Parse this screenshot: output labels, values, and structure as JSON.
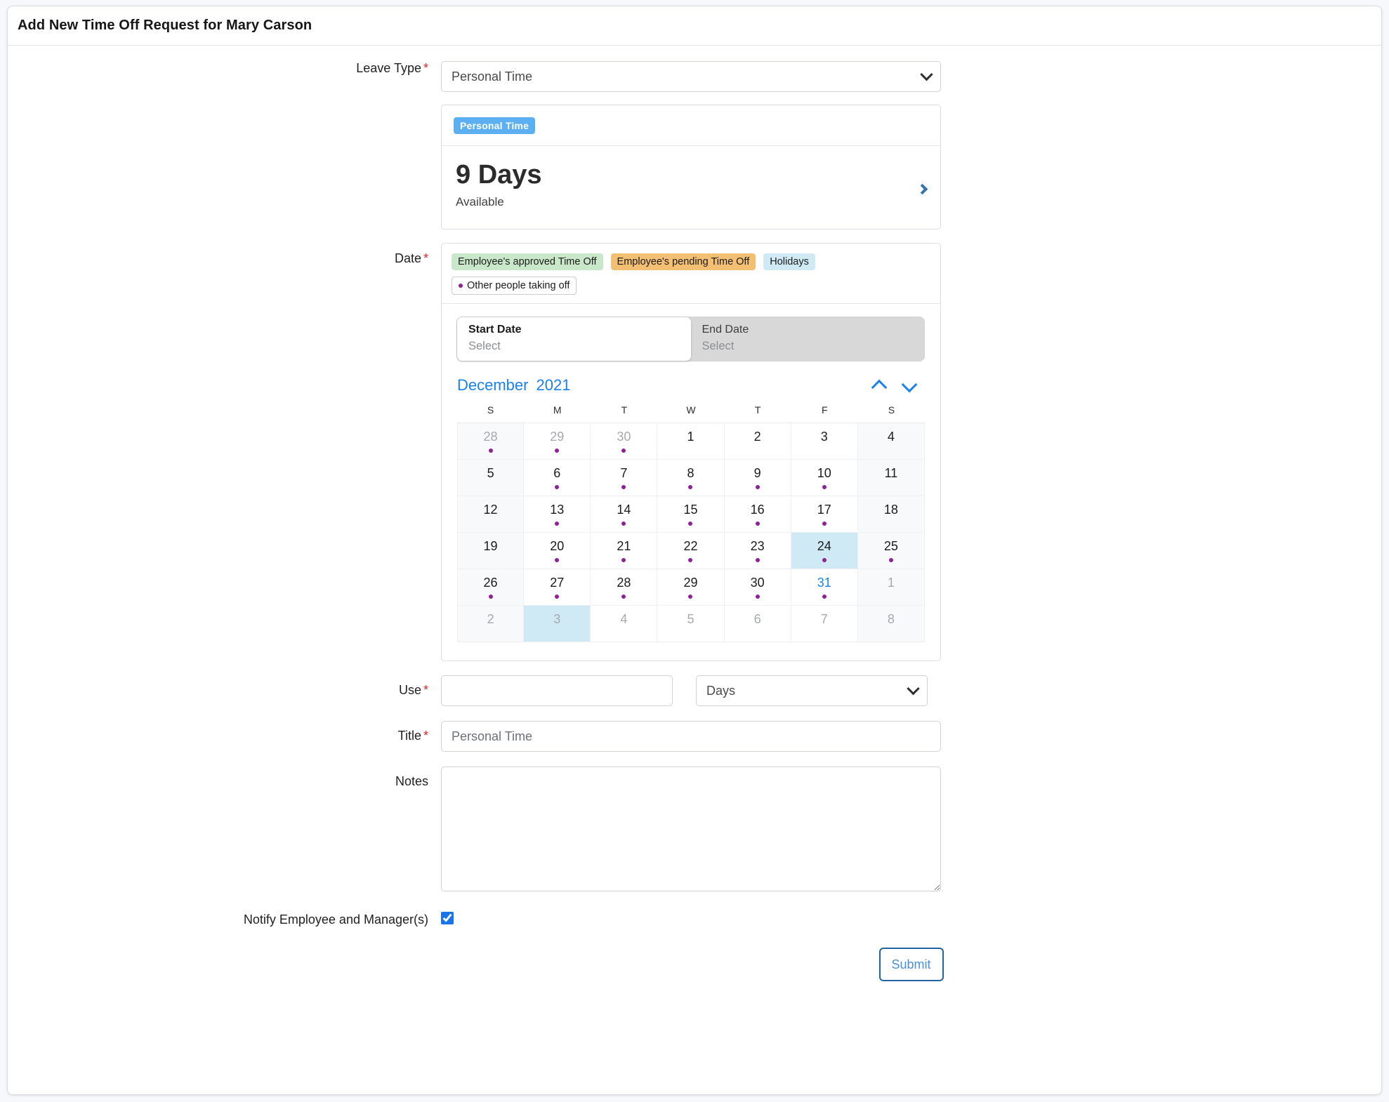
{
  "header": {
    "title": "Add New Time Off Request for Mary Carson"
  },
  "colors": {
    "accent_blue": "#1a82f0",
    "pill_blue": "#5cb0f2",
    "chip_approved": "#c9e8c9",
    "chip_pending": "#f3bf72",
    "chip_holiday": "#cfeaf5",
    "other_dot": "#8e2196",
    "required_star": "#ee2222",
    "submit_border": "#21659e",
    "submit_text": "#4a90d9"
  },
  "leave_type": {
    "label": "Leave Type",
    "required": "*",
    "value": "Personal Time",
    "options": [
      "Personal Time"
    ]
  },
  "balance": {
    "pill_label": "Personal Time",
    "amount": "9 Days",
    "caption": "Available",
    "chevron_icon": "chevron-right-icon"
  },
  "date": {
    "label": "Date",
    "required": "*",
    "legend": [
      {
        "text": "Employee's approved Time Off",
        "style": "approved"
      },
      {
        "text": "Employee's pending Time Off",
        "style": "pending"
      },
      {
        "text": "Holidays",
        "style": "holiday"
      },
      {
        "text": "Other people taking off",
        "style": "other"
      }
    ],
    "start": {
      "title": "Start Date",
      "value": "Select"
    },
    "end": {
      "title": "End Date",
      "value": "Select"
    },
    "calendar": {
      "month": "December",
      "year": "2021",
      "prev_icon": "chevron-up-icon",
      "next_icon": "chevron-down-icon",
      "weekdays": [
        "S",
        "M",
        "T",
        "W",
        "T",
        "F",
        "S"
      ],
      "weeks": [
        [
          {
            "n": "28",
            "muted": true,
            "weekend": true,
            "dot": true
          },
          {
            "n": "29",
            "muted": true,
            "dot": true
          },
          {
            "n": "30",
            "muted": true,
            "dot": true
          },
          {
            "n": "1"
          },
          {
            "n": "2"
          },
          {
            "n": "3"
          },
          {
            "n": "4",
            "weekend": true
          }
        ],
        [
          {
            "n": "5",
            "weekend": true
          },
          {
            "n": "6",
            "dot": true
          },
          {
            "n": "7",
            "dot": true
          },
          {
            "n": "8",
            "dot": true
          },
          {
            "n": "9",
            "dot": true
          },
          {
            "n": "10",
            "dot": true
          },
          {
            "n": "11",
            "weekend": true
          }
        ],
        [
          {
            "n": "12",
            "weekend": true
          },
          {
            "n": "13",
            "dot": true
          },
          {
            "n": "14",
            "dot": true
          },
          {
            "n": "15",
            "dot": true
          },
          {
            "n": "16",
            "dot": true
          },
          {
            "n": "17",
            "dot": true
          },
          {
            "n": "18",
            "weekend": true
          }
        ],
        [
          {
            "n": "19",
            "weekend": true
          },
          {
            "n": "20",
            "dot": true
          },
          {
            "n": "21",
            "dot": true
          },
          {
            "n": "22",
            "dot": true
          },
          {
            "n": "23",
            "dot": true
          },
          {
            "n": "24",
            "dot": true,
            "holiday": true
          },
          {
            "n": "25",
            "weekend": true,
            "dot": true
          }
        ],
        [
          {
            "n": "26",
            "weekend": true,
            "dot": true
          },
          {
            "n": "27",
            "dot": true
          },
          {
            "n": "28",
            "dot": true
          },
          {
            "n": "29",
            "dot": true
          },
          {
            "n": "30",
            "dot": true
          },
          {
            "n": "31",
            "dot": true,
            "today": true
          },
          {
            "n": "1",
            "weekend": true,
            "muted": true
          }
        ],
        [
          {
            "n": "2",
            "weekend": true,
            "muted": true
          },
          {
            "n": "3",
            "muted": true,
            "holiday": true
          },
          {
            "n": "4",
            "muted": true
          },
          {
            "n": "5",
            "muted": true
          },
          {
            "n": "6",
            "muted": true
          },
          {
            "n": "7",
            "muted": true
          },
          {
            "n": "8",
            "weekend": true,
            "muted": true
          }
        ]
      ]
    }
  },
  "use": {
    "label": "Use",
    "required": "*",
    "value": "",
    "placeholder": "",
    "unit_value": "Days",
    "unit_options": [
      "Days"
    ]
  },
  "title_field": {
    "label": "Title",
    "required": "*",
    "value": "",
    "placeholder": "Personal Time"
  },
  "notes": {
    "label": "Notes",
    "value": "",
    "placeholder": ""
  },
  "notify": {
    "label": "Notify Employee and Manager(s)",
    "checked": true
  },
  "submit": {
    "label": "Submit"
  }
}
